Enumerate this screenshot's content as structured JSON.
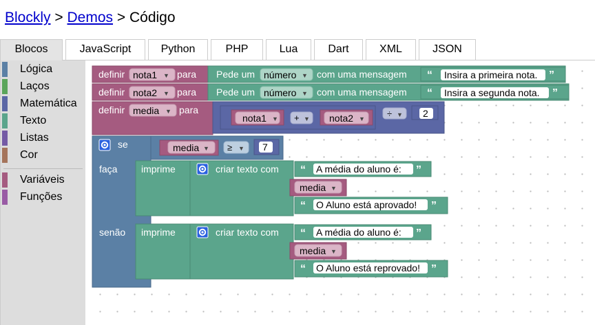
{
  "breadcrumb": {
    "blockly": "Blockly",
    "sep1": ">",
    "demos": "Demos",
    "sep2": ">",
    "current": "Código"
  },
  "tabs": [
    {
      "label": "Blocos",
      "active": true
    },
    {
      "label": "JavaScript"
    },
    {
      "label": "Python"
    },
    {
      "label": "PHP"
    },
    {
      "label": "Lua"
    },
    {
      "label": "Dart"
    },
    {
      "label": "XML"
    },
    {
      "label": "JSON"
    }
  ],
  "toolbox": {
    "categories": [
      {
        "label": "Lógica",
        "color": "#5b80a5"
      },
      {
        "label": "Laços",
        "color": "#5ba55b"
      },
      {
        "label": "Matemática",
        "color": "#5b67a5"
      },
      {
        "label": "Texto",
        "color": "#5ba58c"
      },
      {
        "label": "Listas",
        "color": "#745ba5"
      },
      {
        "label": "Cor",
        "color": "#a5745b"
      }
    ],
    "variables": [
      {
        "label": "Variáveis",
        "color": "#a55b80"
      },
      {
        "label": "Funções",
        "color": "#995ba5"
      }
    ]
  },
  "colors": {
    "variables": "#a55b80",
    "text": "#5ba58c",
    "math": "#5b67a5",
    "logic": "#5b80a5",
    "field_bg": "#ffffff"
  },
  "blocks": {
    "set1": {
      "prefix": "definir",
      "var": "nota1",
      "suffix": "para"
    },
    "prompt1": {
      "label": "Pede um",
      "type": "número",
      "tail": "com uma mensagem",
      "message": "Insira a primeira nota."
    },
    "set2": {
      "prefix": "definir",
      "var": "nota2",
      "suffix": "para"
    },
    "prompt2": {
      "label": "Pede um",
      "type": "número",
      "tail": "com uma mensagem",
      "message": "Insira a segunda nota."
    },
    "set3": {
      "prefix": "definir",
      "var": "media",
      "suffix": "para"
    },
    "arith": {
      "a": "nota1",
      "op": "+",
      "b": "nota2",
      "op2": "÷",
      "divisor": "2"
    },
    "if": {
      "if_label": "se",
      "do_label": "faça",
      "else_label": "senão"
    },
    "compare": {
      "var": "media",
      "op": "≥",
      "value": "7"
    },
    "print1": {
      "label": "imprime",
      "join": "criar texto com",
      "text1": "A média do aluno é:",
      "var": "media",
      "text2": "O Aluno está aprovado!"
    },
    "print2": {
      "label": "imprime",
      "join": "criar texto com",
      "text1": "A média do aluno é:",
      "var": "media",
      "text2": "O Aluno está reprovado!"
    },
    "quote_open": "“",
    "quote_close": "”"
  }
}
